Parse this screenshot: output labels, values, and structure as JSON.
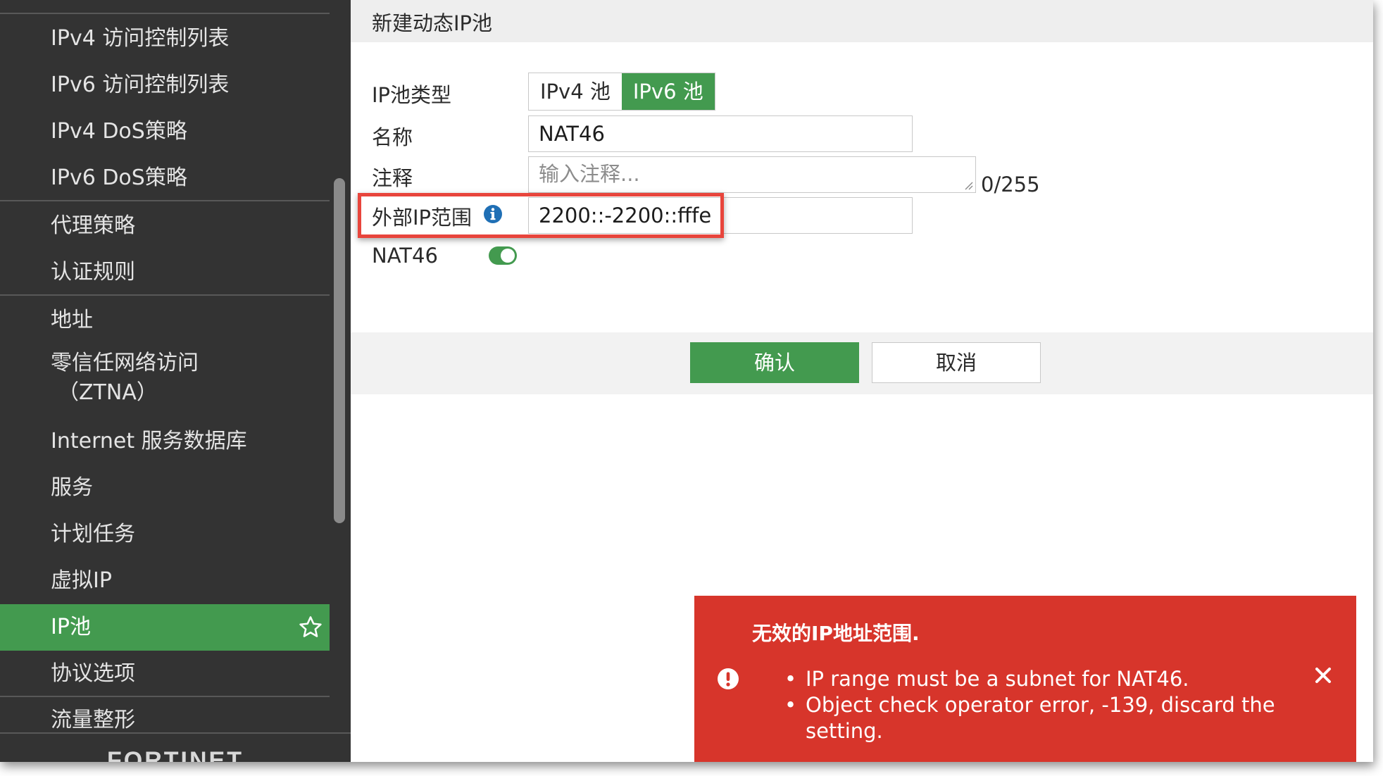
{
  "sidebar": {
    "items": [
      {
        "label": "IPv4 访问控制列表"
      },
      {
        "label": "IPv6 访问控制列表"
      },
      {
        "label": "IPv4 DoS策略"
      },
      {
        "label": "IPv6 DoS策略"
      },
      {
        "label": "代理策略"
      },
      {
        "label": "认证规则"
      },
      {
        "label": "地址"
      },
      {
        "label": "零信任网络访问",
        "label2": "（ZTNA）"
      },
      {
        "label": "Internet 服务数据库"
      },
      {
        "label": "服务"
      },
      {
        "label": "计划任务"
      },
      {
        "label": "虚拟IP"
      },
      {
        "label": "IP池",
        "active": true
      },
      {
        "label": "协议选项"
      },
      {
        "label": "流量整形"
      }
    ],
    "favorite_icon": "star-outline-icon",
    "logo_text": "FORTINET",
    "logo_suffix": "•••"
  },
  "dialog": {
    "title": "新建动态IP池",
    "fields": {
      "type_label": "IP池类型",
      "type_options": [
        "IPv4 池",
        "IPv6 池"
      ],
      "type_selected": "IPv6 池",
      "name_label": "名称",
      "name_value": "NAT46",
      "comment_label": "注释",
      "comment_placeholder": "输入注释...",
      "comment_counter": "0/255",
      "range_label": "外部IP范围",
      "range_value": "2200::-2200::fffe",
      "nat46_label": "NAT46",
      "nat46_enabled": true
    },
    "buttons": {
      "ok": "确认",
      "cancel": "取消"
    }
  },
  "error_toast": {
    "title": "无效的IP地址范围.",
    "messages": [
      "IP range must be a subnet for NAT46.",
      "Object check operator error, -139, discard the setting."
    ],
    "icon": "exclamation-circle-icon",
    "close_icon": "close-icon"
  },
  "colors": {
    "sidebar_bg": "#333333",
    "accent_green": "#439a4f",
    "error_red": "#d7352b",
    "highlight_red": "#e8453c",
    "info_blue": "#1f6fb5"
  }
}
